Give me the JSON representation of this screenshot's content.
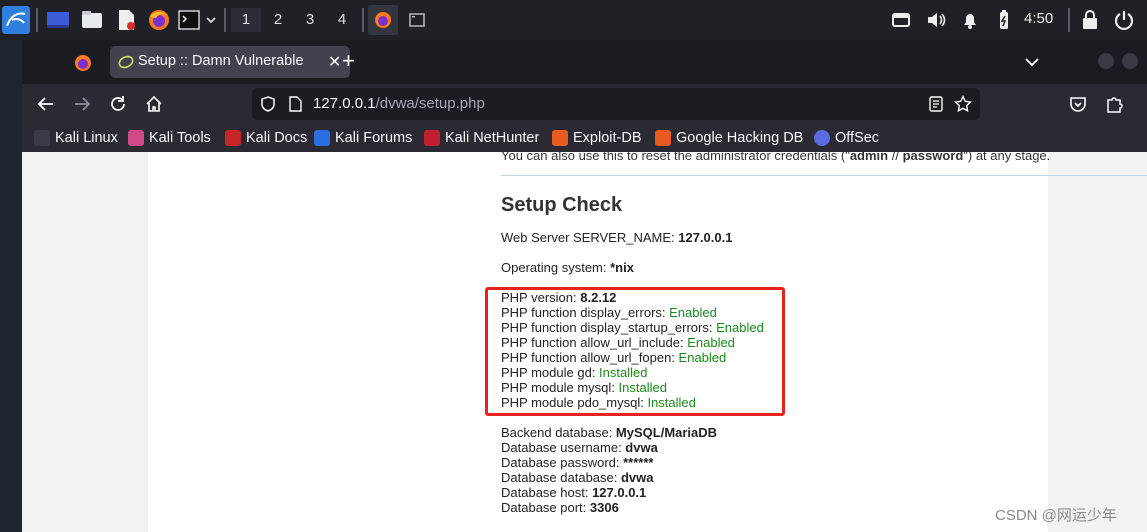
{
  "taskbar": {
    "workspaces": [
      "1",
      "2",
      "3",
      "4"
    ],
    "clock": "4:50",
    "icons": [
      "kali-menu-icon",
      "workspace-preview-icon",
      "file-manager-icon",
      "text-editor-icon",
      "firefox-icon",
      "terminal-icon",
      "volume-icon",
      "bell-icon",
      "battery-icon",
      "lock-icon",
      "power-icon"
    ]
  },
  "browser": {
    "tab_title": "Setup :: Damn Vulnerable",
    "url_host": "127.0.0.1",
    "url_path": "/dvwa/setup.php",
    "bookmarks": [
      "Kali Linux",
      "Kali Tools",
      "Kali Docs",
      "Kali Forums",
      "Kali NetHunter",
      "Exploit-DB",
      "Google Hacking DB",
      "OffSec"
    ]
  },
  "page": {
    "cut_text": {
      "before": "You can also use this to reset the administrator credentials (\"",
      "user": "admin",
      "sep": " // ",
      "password": "password",
      "after": "\") at any stage."
    },
    "heading": "Setup Check",
    "server": {
      "label": "Web Server SERVER_NAME: ",
      "value": "127.0.0.1"
    },
    "os": {
      "label": "Operating system: ",
      "value": "*nix"
    },
    "php_version": {
      "label": "PHP version: ",
      "value": "8.2.12"
    },
    "php_checks": [
      {
        "label": "PHP function display_errors: ",
        "status": "Enabled"
      },
      {
        "label": "PHP function display_startup_errors: ",
        "status": "Enabled"
      },
      {
        "label": "PHP function allow_url_include: ",
        "status": "Enabled"
      },
      {
        "label": "PHP function allow_url_fopen: ",
        "status": "Enabled"
      },
      {
        "label": "PHP module gd: ",
        "status": "Installed"
      },
      {
        "label": "PHP module mysql: ",
        "status": "Installed"
      },
      {
        "label": "PHP module pdo_mysql: ",
        "status": "Installed"
      }
    ],
    "db": [
      {
        "label": "Backend database: ",
        "value": "MySQL/MariaDB"
      },
      {
        "label": "Database username: ",
        "value": "dvwa"
      },
      {
        "label": "Database password: ",
        "value": "******"
      },
      {
        "label": "Database database: ",
        "value": "dvwa"
      },
      {
        "label": "Database host: ",
        "value": "127.0.0.1"
      },
      {
        "label": "Database port: ",
        "value": "3306"
      }
    ]
  },
  "watermark": "CSDN @网运少年",
  "colors": {
    "status_green": "#1a8a1a",
    "highlight_red": "#e8231f",
    "kali_blue": "#2f7fe0"
  }
}
